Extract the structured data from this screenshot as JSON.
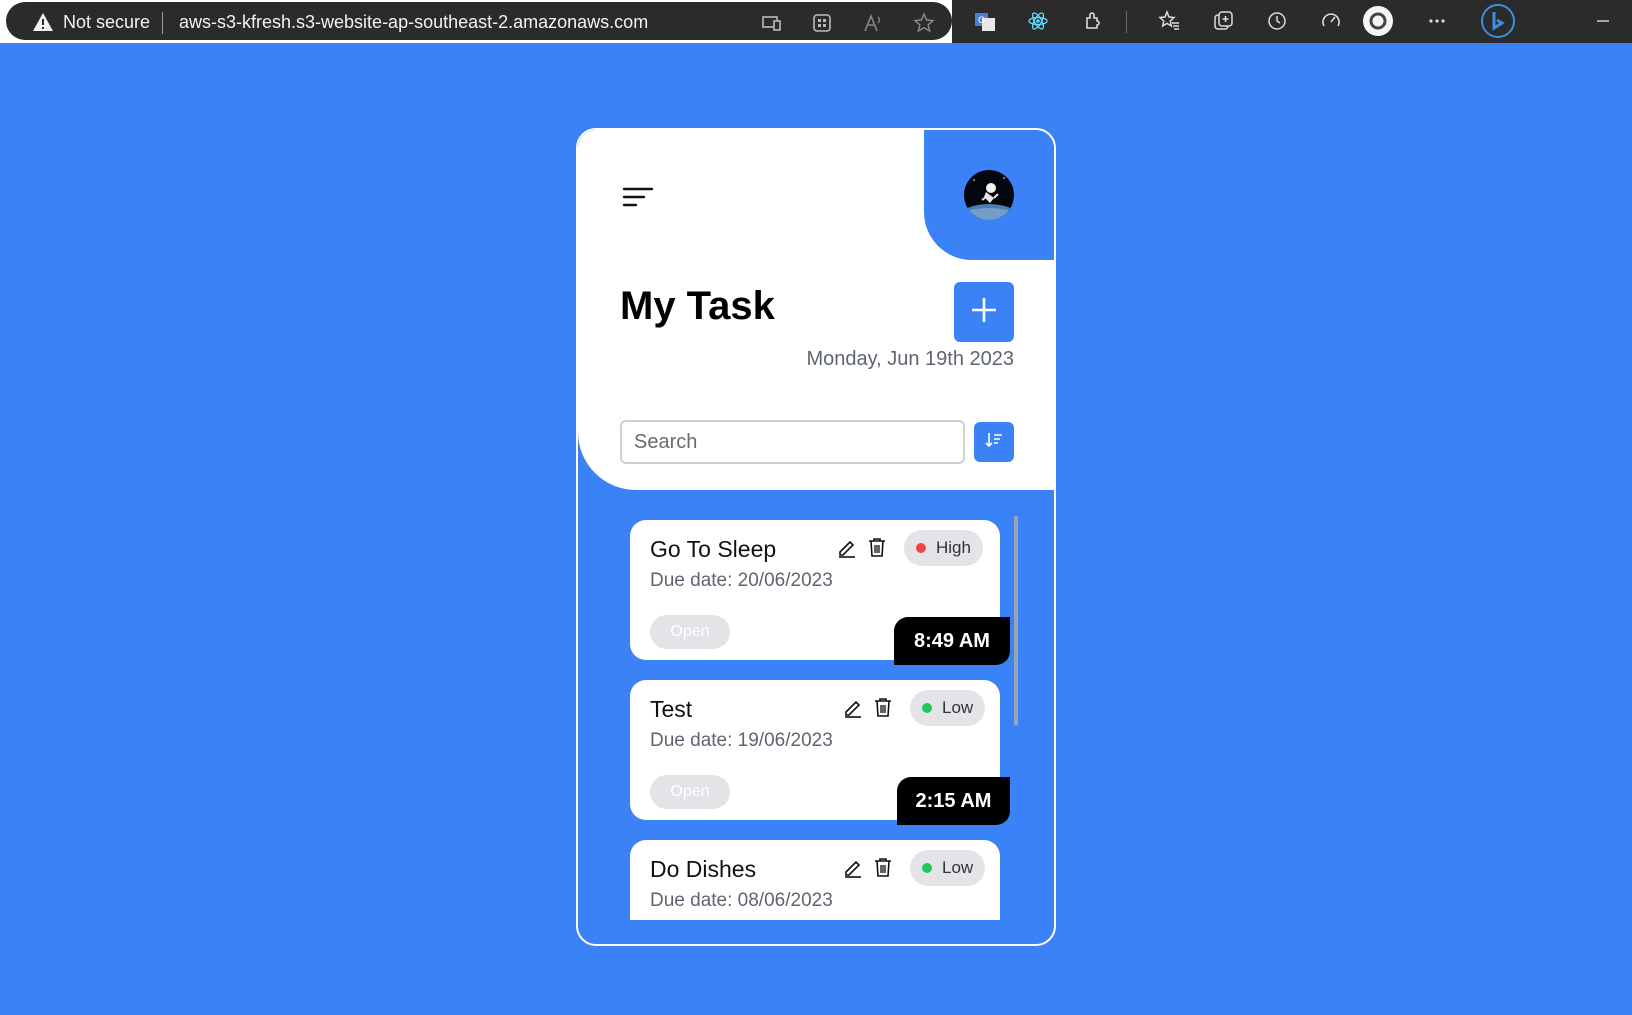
{
  "browser": {
    "security_label": "Not secure",
    "url": "aws-s3-kfresh.s3-website-ap-southeast-2.amazonaws.com",
    "icons": [
      "warning-icon",
      "app-available-icon",
      "tab-grid-icon",
      "read-aloud-icon",
      "favorite-star-icon",
      "translate-icon",
      "react-devtools-icon",
      "extensions-icon",
      "favorites-icon",
      "collections-icon",
      "history-icon",
      "performance-icon",
      "profile-icon",
      "more-icon",
      "bing-icon",
      "minimize-icon"
    ]
  },
  "header": {
    "title": "My Task",
    "date": "Monday, Jun 19th 2023"
  },
  "search": {
    "placeholder": "Search",
    "value": ""
  },
  "colors": {
    "accent": "#3b82f6",
    "high": "#ef4444",
    "low": "#22c55e",
    "badge_bg": "#e2e4e8"
  },
  "tasks": [
    {
      "title": "Go To Sleep",
      "due": "Due date: 20/06/2023",
      "priority": "High",
      "status": "Open",
      "time": "8:49 AM"
    },
    {
      "title": "Test",
      "due": "Due date: 19/06/2023",
      "priority": "Low",
      "status": "Open",
      "time": "2:15 AM"
    },
    {
      "title": "Do Dishes",
      "due": "Due date: 08/06/2023",
      "priority": "Low",
      "status": "",
      "time": ""
    }
  ]
}
